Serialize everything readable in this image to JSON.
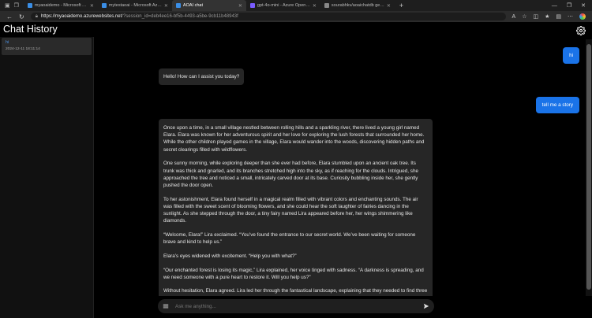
{
  "browser": {
    "tabs": [
      {
        "label": "myaoaidemo - Microsoft Azure",
        "color": "#3a8ee6"
      },
      {
        "label": "mytestaoai - Microsoft Azure",
        "color": "#3a8ee6"
      },
      {
        "label": "AOAI chat",
        "color": "#3a8ee6",
        "active": true
      },
      {
        "label": "gpt-4o-mini - Azure OpenAI Stu",
        "color": "#7a5cff"
      },
      {
        "label": "sourabhkv/aoaichatdb general",
        "color": "#888888"
      }
    ],
    "url_host": "https://myaoaidemo.azurewebsites.net",
    "url_path": "/?session_id=deb4ee16-bf5b-4493-a5be-9cb11b48943f"
  },
  "sidebar": {
    "title": "Chat History",
    "items": [
      {
        "title": "hi",
        "time": "2024-12-11 18:11:14"
      }
    ]
  },
  "messages": {
    "user1": "hi",
    "bot1": "Hello! How can I assist you today?",
    "user2": "tell me a story",
    "story": [
      "Once upon a time, in a small village nestled between rolling hills and a sparkling river, there lived a young girl named Elara. Elara was known for her adventurous spirit and her love for exploring the lush forests that surrounded her home. While the other children played games in the village, Elara would wander into the woods, discovering hidden paths and secret clearings filled with wildflowers.",
      "One sunny morning, while exploring deeper than she ever had before, Elara stumbled upon an ancient oak tree. Its trunk was thick and gnarled, and its branches stretched high into the sky, as if reaching for the clouds. Intrigued, she approached the tree and noticed a small, intricately carved door at its base. Curiosity bubbling inside her, she gently pushed the door open.",
      "To her astonishment, Elara found herself in a magical realm filled with vibrant colors and enchanting sounds. The air was filled with the sweet scent of blooming flowers, and she could hear the soft laughter of fairies dancing in the sunlight. As she stepped through the door, a tiny fairy named Lira appeared before her, her wings shimmering like diamonds.",
      "“Welcome, Elara!” Lira exclaimed. “You’ve found the entrance to our secret world. We’ve been waiting for someone brave and kind to help us.”",
      "Elara’s eyes widened with excitement. “Help you with what?”",
      "“Our enchanted forest is losing its magic,” Lira explained, her voice tinged with sadness. “A darkness is spreading, and we need someone with a pure heart to restore it. Will you help us?”",
      "Without hesitation, Elara agreed. Lira led her through the fantastical landscape, explaining that they needed to find three magical crystals hidden in different parts of the forest. Each crystal was guarded by a challenge that would test Elara’s courage, kindness, and wisdom."
    ]
  },
  "composer": {
    "placeholder": "Ask me anything..."
  },
  "colors": {
    "user_bubble": "#1a73e8",
    "bot_bubble": "#262626",
    "link": "#4a90e2"
  }
}
